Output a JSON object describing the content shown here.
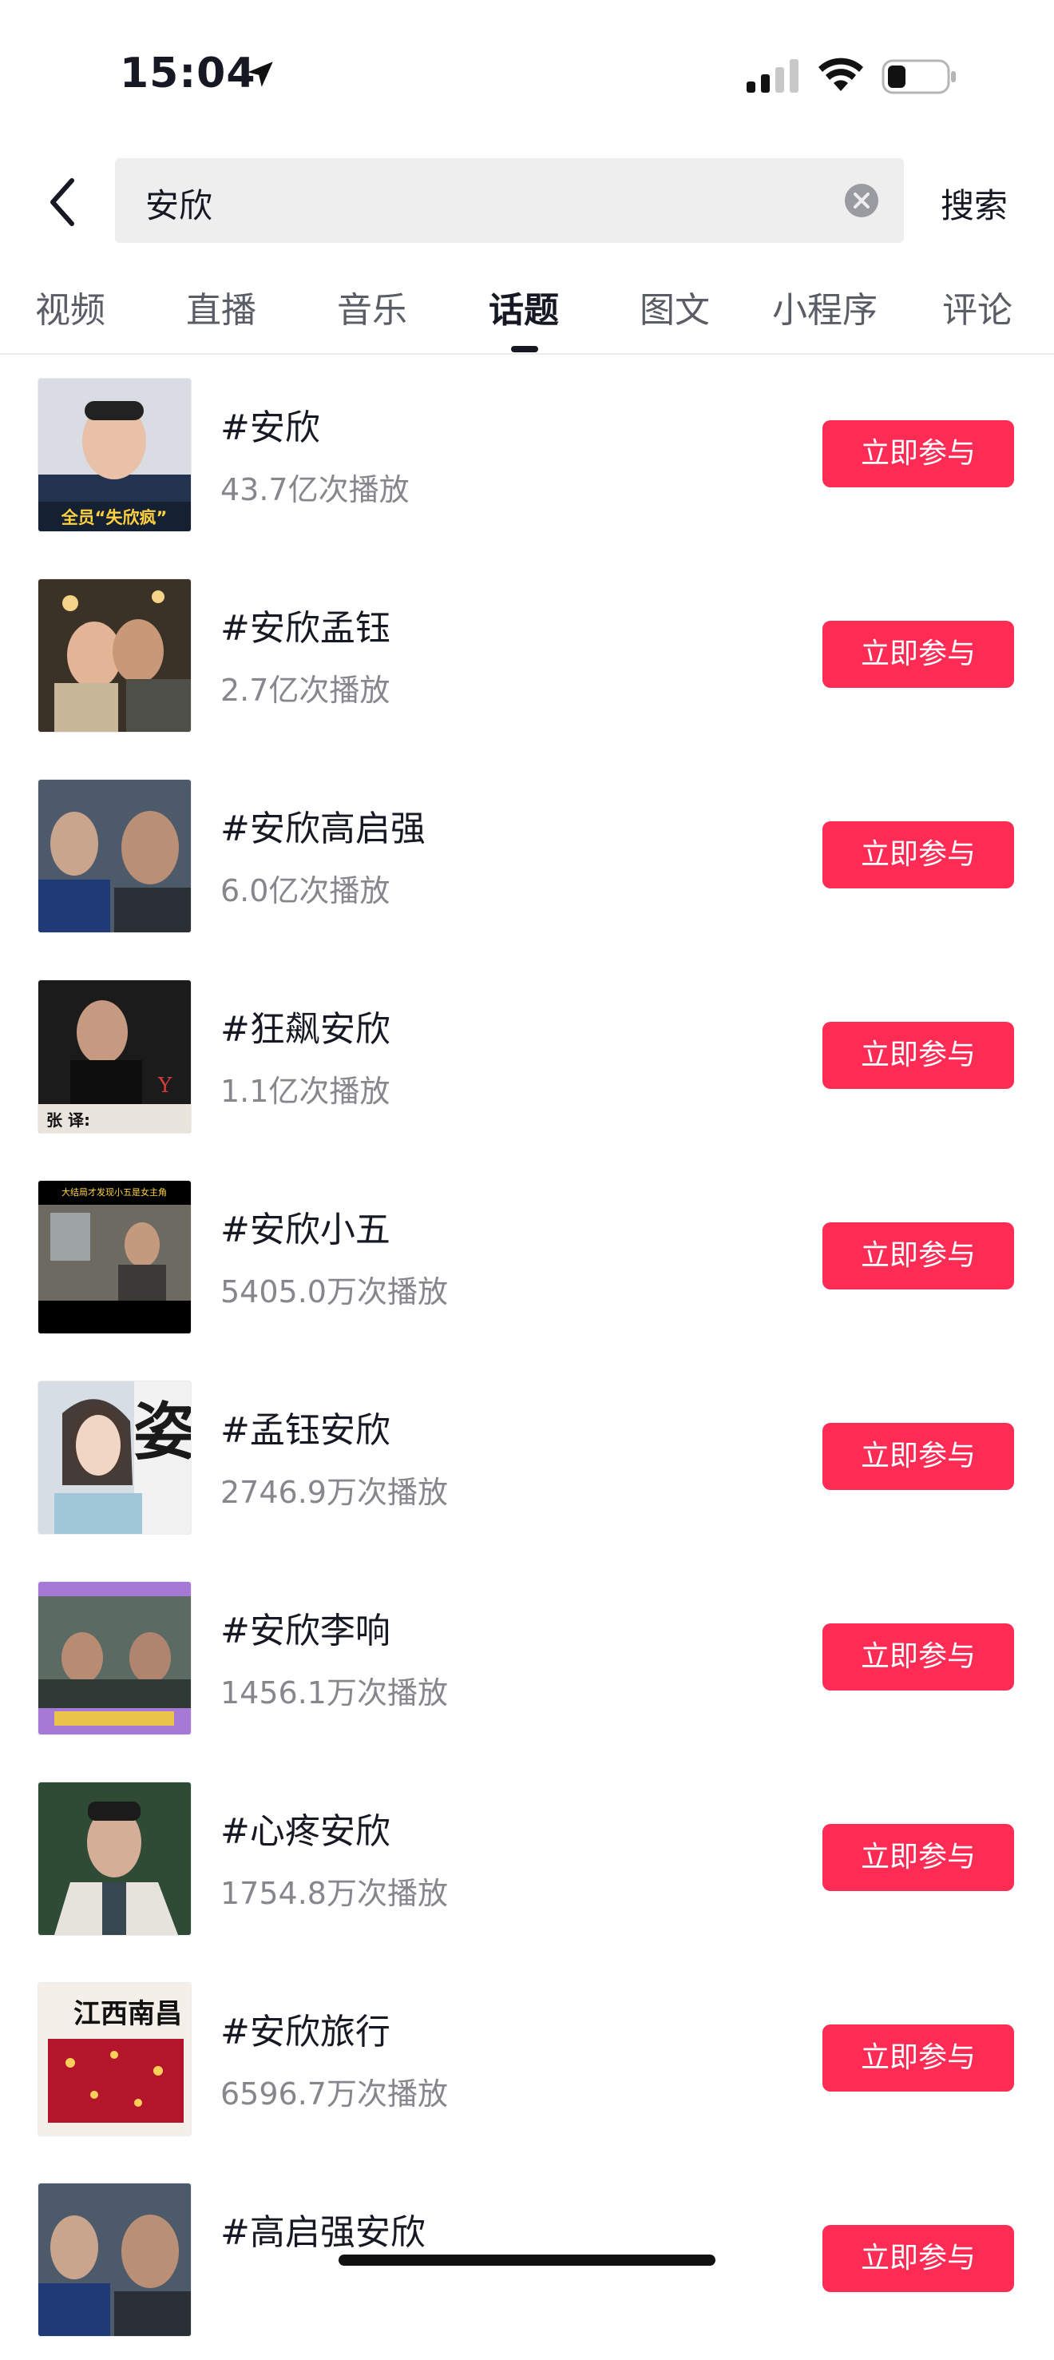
{
  "status_bar": {
    "time": "15:04",
    "icons": [
      "location-arrow-icon",
      "cellular-signal-icon",
      "wifi-icon",
      "battery-icon"
    ]
  },
  "search": {
    "query": "安欣",
    "submit_label": "搜索",
    "icons": [
      "back-chevron-icon",
      "clear-icon"
    ]
  },
  "tabs": [
    {
      "label": "视频"
    },
    {
      "label": "直播"
    },
    {
      "label": "音乐"
    },
    {
      "label": "话题",
      "active": true
    },
    {
      "label": "图文"
    },
    {
      "label": "小程序"
    },
    {
      "label": "评论"
    }
  ],
  "topics": [
    {
      "name": "#安欣",
      "plays": "43.7亿次播放",
      "thumb_caption": "全员“失欣疯”",
      "button": "立即参与"
    },
    {
      "name": "#安欣孟钰",
      "plays": "2.7亿次播放",
      "button": "立即参与"
    },
    {
      "name": "#安欣高启强",
      "plays": "6.0亿次播放",
      "button": "立即参与"
    },
    {
      "name": "#狂飙安欣",
      "plays": "1.1亿次播放",
      "thumb_caption": "张 译:",
      "button": "立即参与"
    },
    {
      "name": "#安欣小五",
      "plays": "5405.0万次播放",
      "thumb_caption": "大结局才发现小五是女主角",
      "button": "立即参与"
    },
    {
      "name": "#孟钰安欣",
      "plays": "2746.9万次播放",
      "thumb_caption": "姿",
      "button": "立即参与"
    },
    {
      "name": "#安欣李响",
      "plays": "1456.1万次播放",
      "button": "立即参与"
    },
    {
      "name": "#心疼安欣",
      "plays": "1754.8万次播放",
      "button": "立即参与"
    },
    {
      "name": "#安欣旅行",
      "plays": "6596.7万次播放",
      "thumb_caption": "江西南昌",
      "button": "立即参与"
    },
    {
      "name": "#高启强安欣",
      "plays": "",
      "button": "立即参与"
    }
  ],
  "colors": {
    "accent": "#fe2c55",
    "text_primary": "#161823",
    "text_secondary": "#86878c",
    "search_bg": "#eeeeef"
  }
}
